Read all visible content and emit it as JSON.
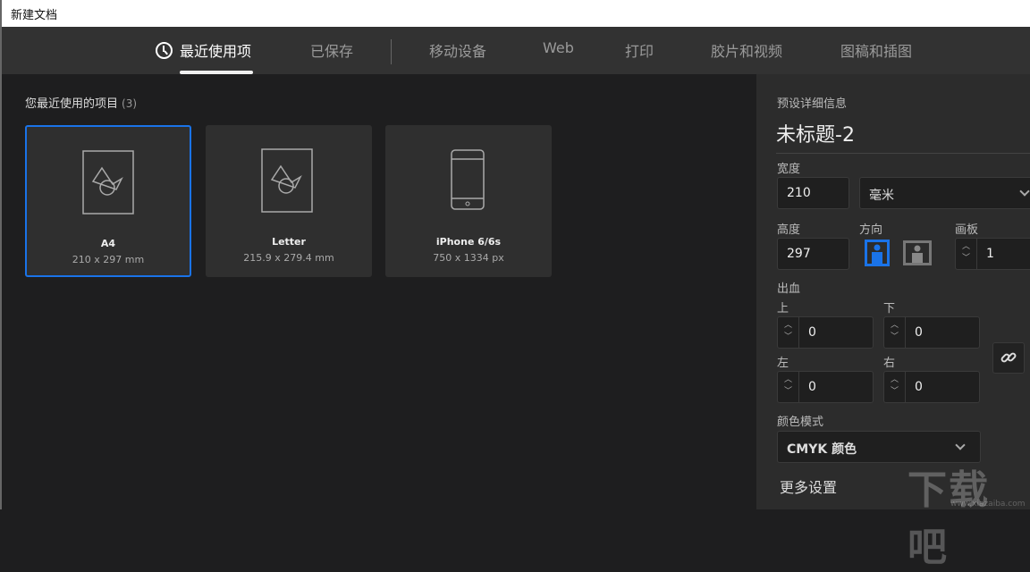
{
  "window": {
    "title": "新建文档"
  },
  "tabs": [
    {
      "label": "最近使用项",
      "icon": "clock-icon",
      "active": true
    },
    {
      "label": "已保存"
    },
    {
      "label": "移动设备"
    },
    {
      "label": "Web"
    },
    {
      "label": "打印"
    },
    {
      "label": "胶片和视频"
    },
    {
      "label": "图稿和插图"
    }
  ],
  "recent": {
    "title": "您最近使用的项目",
    "count": "(3)",
    "items": [
      {
        "name": "A4",
        "size": "210 x 297 mm",
        "icon": "document-icon"
      },
      {
        "name": "Letter",
        "size": "215.9 x 279.4 mm",
        "icon": "document-icon"
      },
      {
        "name": "iPhone 6/6s",
        "size": "750 x 1334 px",
        "icon": "phone-icon"
      }
    ]
  },
  "preset": {
    "header": "预设详细信息",
    "doc_name": "未标题-2",
    "width_label": "宽度",
    "width": "210",
    "unit": "毫米",
    "height_label": "高度",
    "height": "297",
    "orientation_label": "方向",
    "artboard_label": "画板",
    "artboards": "1",
    "bleed_label": "出血",
    "top_label": "上",
    "top": "0",
    "bottom_label": "下",
    "bottom": "0",
    "left_label": "左",
    "left": "0",
    "right_label": "右",
    "right": "0",
    "color_mode_label": "颜色模式",
    "color_mode": "CMYK 颜色",
    "more_settings": "更多设置"
  },
  "watermark": {
    "text": "下载吧",
    "url": "www.xiazaiba.com"
  }
}
